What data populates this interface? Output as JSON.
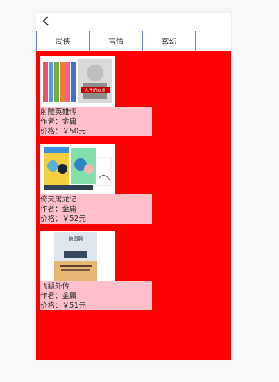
{
  "header": {
    "back_icon": "chevron-left-icon"
  },
  "tabs": [
    {
      "label": "武侠"
    },
    {
      "label": "言情"
    },
    {
      "label": "玄幻"
    }
  ],
  "books": [
    {
      "title": "射雕英雄传",
      "author": "作者：金庸",
      "price": "价格：￥50元",
      "cover_label": "人性的弱点"
    },
    {
      "title": "倚天屠龙记",
      "author": "作者：金庸",
      "price": "价格：￥52元"
    },
    {
      "title": "飞狐外传",
      "author": "作者：金庸",
      "price": "价格：￥51元",
      "cover_label": "狼图腾"
    }
  ],
  "colors": {
    "content_bg": "#ff0000",
    "info_bg": "#ffc0cb",
    "tab_border": "#6f7dd1"
  }
}
